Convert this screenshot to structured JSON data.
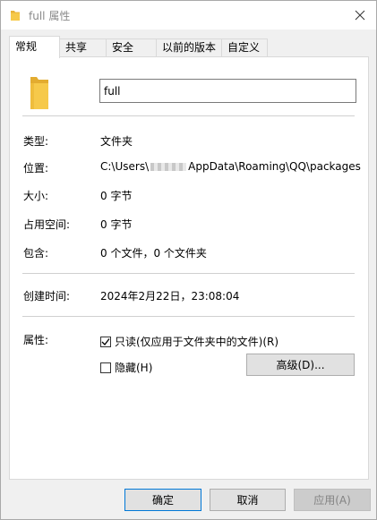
{
  "window": {
    "title": "full 属性",
    "close_label": "✕"
  },
  "tabs": [
    {
      "label": "常规",
      "active": true
    },
    {
      "label": "共享"
    },
    {
      "label": "安全"
    },
    {
      "label": "以前的版本"
    },
    {
      "label": "自定义"
    }
  ],
  "general": {
    "name_value": "full",
    "type": {
      "label": "类型:",
      "value": "文件夹"
    },
    "location": {
      "label": "位置:",
      "value_prefix": "C:\\Users\\",
      "value_suffix": "AppData\\Roaming\\QQ\\packages"
    },
    "size": {
      "label": "大小:",
      "value": "0 字节"
    },
    "size_on_disk": {
      "label": "占用空间:",
      "value": "0 字节"
    },
    "contains": {
      "label": "包含:",
      "value": "0 个文件，0 个文件夹"
    },
    "created": {
      "label": "创建时间:",
      "value": "2024年2月22日，23:08:04"
    },
    "attributes": {
      "label": "属性:",
      "readonly_label": "只读(仅应用于文件夹中的文件)(R)",
      "readonly_checked": true,
      "hidden_label": "隐藏(H)",
      "hidden_checked": false,
      "advanced_label": "高级(D)..."
    }
  },
  "buttons": {
    "ok": "确定",
    "cancel": "取消",
    "apply": "应用(A)"
  },
  "colors": {
    "folder": "#f6c94a",
    "primary_border": "#0078d7"
  }
}
